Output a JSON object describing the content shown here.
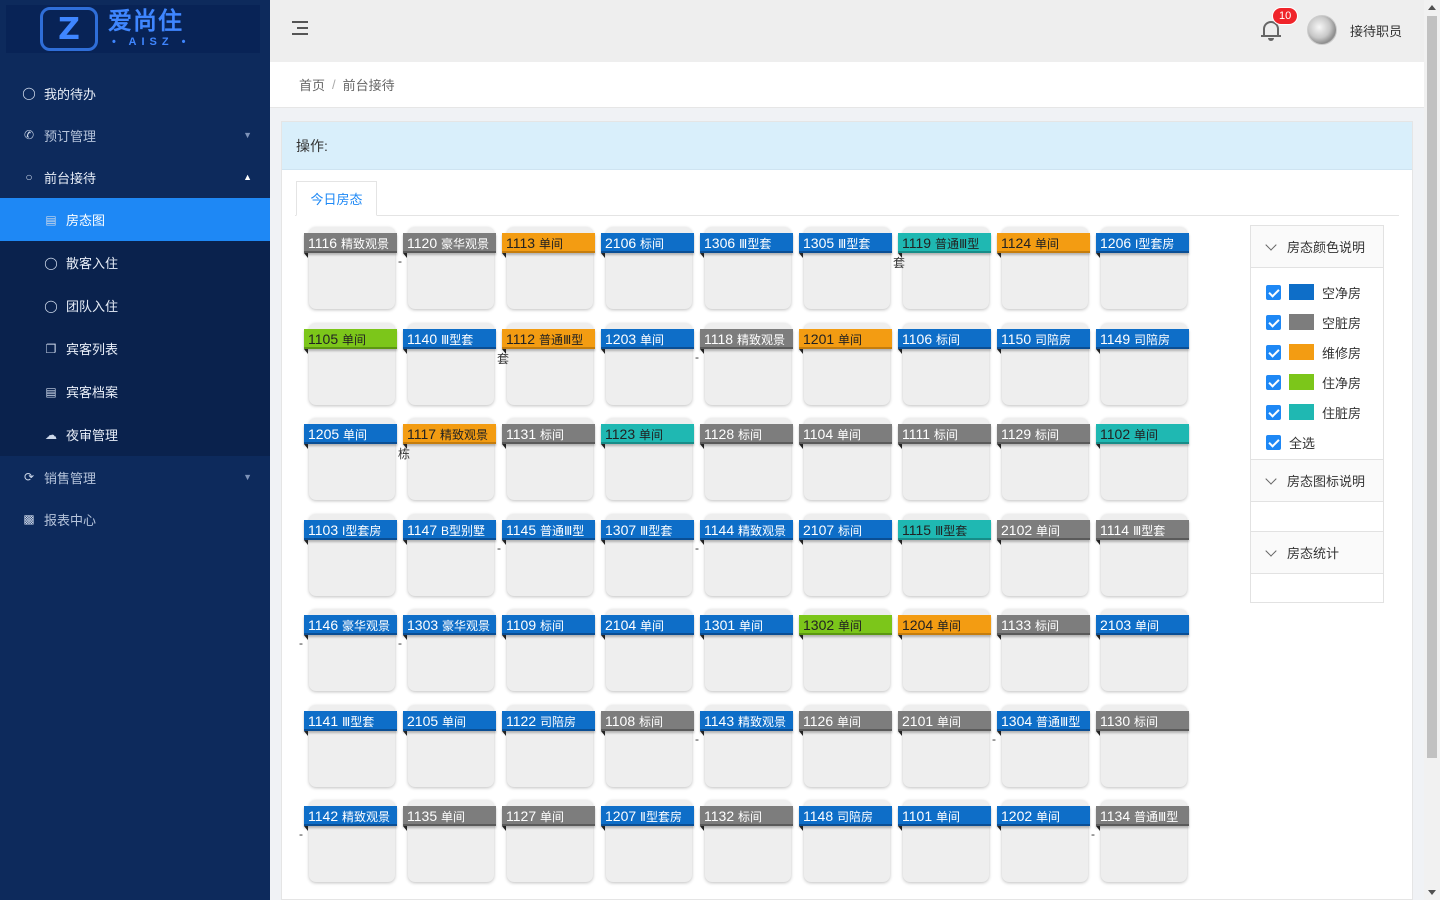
{
  "brand": {
    "logo_cn": "爱尚住",
    "logo_en": "• AISZ •"
  },
  "sidebar": {
    "items": [
      {
        "label": "我的待办",
        "icon": "user-icon"
      },
      {
        "label": "预订管理",
        "icon": "phone-icon",
        "arrow": "⌄"
      },
      {
        "label": "前台接待",
        "icon": "chat-icon",
        "arrow": "⌃"
      },
      {
        "label": "销售管理",
        "icon": "refresh-icon",
        "arrow": "⌄"
      },
      {
        "label": "报表中心",
        "icon": "bar-chart-icon"
      }
    ],
    "subitems": [
      {
        "label": "房态图",
        "icon": "chart-icon"
      },
      {
        "label": "散客入住",
        "icon": "user-icon"
      },
      {
        "label": "团队入住",
        "icon": "group-icon"
      },
      {
        "label": "宾客列表",
        "icon": "copy-icon"
      },
      {
        "label": "宾客档案",
        "icon": "file-icon"
      },
      {
        "label": "夜审管理",
        "icon": "cloud-icon"
      }
    ]
  },
  "header": {
    "notification_count": "10",
    "username": "接待职员"
  },
  "breadcrumb": {
    "home": "首页",
    "sep": "/",
    "current": "前台接待"
  },
  "panel": {
    "ops_label": "操作:",
    "tab_label": "今日房态"
  },
  "colors": {
    "空净房": "#0e6ec8",
    "空脏房": "#7d7d7d",
    "维修房": "#f39c12",
    "住净房": "#7cc61a",
    "住脏房": "#1fb8b2"
  },
  "rooms": [
    [
      {
        "no": "1116",
        "type": "精致观景",
        "c": "gray",
        "w": ""
      },
      {
        "no": "1120",
        "type": "豪华观景",
        "c": "gray",
        "w": "-"
      },
      {
        "no": "1113",
        "type": "单间",
        "c": "orange",
        "w": ""
      },
      {
        "no": "2106",
        "type": "标间",
        "c": "blue",
        "w": ""
      },
      {
        "no": "1306",
        "type": "Ⅲ型套",
        "c": "blue",
        "w": ""
      },
      {
        "no": "1305",
        "type": "Ⅲ型套",
        "c": "blue",
        "w": ""
      },
      {
        "no": "1119",
        "type": "普通Ⅲ型",
        "c": "teal",
        "w": "套"
      },
      {
        "no": "1124",
        "type": "单间",
        "c": "orange",
        "w": ""
      },
      {
        "no": "1206",
        "type": "I型套房",
        "c": "blue",
        "w": ""
      }
    ],
    [
      {
        "no": "1105",
        "type": "单间",
        "c": "green",
        "w": ""
      },
      {
        "no": "1140",
        "type": "Ⅲ型套",
        "c": "blue",
        "w": ""
      },
      {
        "no": "1112",
        "type": "普通Ⅲ型",
        "c": "orange",
        "w": "套"
      },
      {
        "no": "1203",
        "type": "单间",
        "c": "blue",
        "w": ""
      },
      {
        "no": "1118",
        "type": "精致观景",
        "c": "gray",
        "w": "-"
      },
      {
        "no": "1201",
        "type": "单间",
        "c": "orange",
        "w": ""
      },
      {
        "no": "1106",
        "type": "标间",
        "c": "blue",
        "w": ""
      },
      {
        "no": "1150",
        "type": "司陪房",
        "c": "blue",
        "w": ""
      },
      {
        "no": "1149",
        "type": "司陪房",
        "c": "blue",
        "w": ""
      }
    ],
    [
      {
        "no": "1205",
        "type": "单间",
        "c": "blue",
        "w": ""
      },
      {
        "no": "1117",
        "type": "精致观景",
        "c": "orange",
        "w": "栋"
      },
      {
        "no": "1131",
        "type": "标间",
        "c": "gray",
        "w": ""
      },
      {
        "no": "1123",
        "type": "单间",
        "c": "teal",
        "w": ""
      },
      {
        "no": "1128",
        "type": "标间",
        "c": "gray",
        "w": ""
      },
      {
        "no": "1104",
        "type": "单间",
        "c": "gray",
        "w": ""
      },
      {
        "no": "1111",
        "type": "标间",
        "c": "gray",
        "w": ""
      },
      {
        "no": "1129",
        "type": "标间",
        "c": "gray",
        "w": ""
      },
      {
        "no": "1102",
        "type": "单间",
        "c": "teal",
        "w": ""
      }
    ],
    [
      {
        "no": "1103",
        "type": "I型套房",
        "c": "blue",
        "w": ""
      },
      {
        "no": "1147",
        "type": "B型别墅",
        "c": "blue",
        "w": ""
      },
      {
        "no": "1145",
        "type": "普通Ⅲ型",
        "c": "blue",
        "w": "-"
      },
      {
        "no": "1307",
        "type": "Ⅲ型套",
        "c": "blue",
        "w": ""
      },
      {
        "no": "1144",
        "type": "精致观景",
        "c": "blue",
        "w": "-"
      },
      {
        "no": "2107",
        "type": "标间",
        "c": "blue",
        "w": ""
      },
      {
        "no": "1115",
        "type": "Ⅲ型套",
        "c": "teal",
        "w": ""
      },
      {
        "no": "2102",
        "type": "单间",
        "c": "gray",
        "w": ""
      },
      {
        "no": "1114",
        "type": "Ⅲ型套",
        "c": "gray",
        "w": ""
      }
    ],
    [
      {
        "no": "1146",
        "type": "豪华观景",
        "c": "blue",
        "w": "-"
      },
      {
        "no": "1303",
        "type": "豪华观景",
        "c": "blue",
        "w": "-"
      },
      {
        "no": "1109",
        "type": "标间",
        "c": "blue",
        "w": ""
      },
      {
        "no": "2104",
        "type": "单间",
        "c": "blue",
        "w": ""
      },
      {
        "no": "1301",
        "type": "单间",
        "c": "blue",
        "w": ""
      },
      {
        "no": "1302",
        "type": "单间",
        "c": "green",
        "w": ""
      },
      {
        "no": "1204",
        "type": "单间",
        "c": "orange",
        "w": ""
      },
      {
        "no": "1133",
        "type": "标间",
        "c": "gray",
        "w": ""
      },
      {
        "no": "2103",
        "type": "单间",
        "c": "blue",
        "w": ""
      }
    ],
    [
      {
        "no": "1141",
        "type": "Ⅲ型套",
        "c": "blue",
        "w": ""
      },
      {
        "no": "2105",
        "type": "单间",
        "c": "blue",
        "w": ""
      },
      {
        "no": "1122",
        "type": "司陪房",
        "c": "blue",
        "w": ""
      },
      {
        "no": "1108",
        "type": "标间",
        "c": "gray",
        "w": ""
      },
      {
        "no": "1143",
        "type": "精致观景",
        "c": "blue",
        "w": "-"
      },
      {
        "no": "1126",
        "type": "单间",
        "c": "gray",
        "w": ""
      },
      {
        "no": "2101",
        "type": "单间",
        "c": "gray",
        "w": ""
      },
      {
        "no": "1304",
        "type": "普通Ⅲ型",
        "c": "blue",
        "w": "-"
      },
      {
        "no": "1130",
        "type": "标间",
        "c": "gray",
        "w": ""
      }
    ],
    [
      {
        "no": "1142",
        "type": "精致观景",
        "c": "blue",
        "w": "-"
      },
      {
        "no": "1135",
        "type": "单间",
        "c": "gray",
        "w": ""
      },
      {
        "no": "1127",
        "type": "单间",
        "c": "gray",
        "w": ""
      },
      {
        "no": "1207",
        "type": "Ⅱ型套房",
        "c": "blue",
        "w": ""
      },
      {
        "no": "1132",
        "type": "标间",
        "c": "gray",
        "w": ""
      },
      {
        "no": "1148",
        "type": "司陪房",
        "c": "blue",
        "w": ""
      },
      {
        "no": "1101",
        "type": "单间",
        "c": "blue",
        "w": ""
      },
      {
        "no": "1202",
        "type": "单间",
        "c": "blue",
        "w": ""
      },
      {
        "no": "1134",
        "type": "普通Ⅲ型",
        "c": "gray",
        "w": "-"
      }
    ]
  ],
  "legend": {
    "color_title": "房态颜色说明",
    "items": [
      {
        "label": "空净房",
        "color": "#0e6ec8"
      },
      {
        "label": "空脏房",
        "color": "#7d7d7d"
      },
      {
        "label": "维修房",
        "color": "#f39c12"
      },
      {
        "label": "住净房",
        "color": "#7cc61a"
      },
      {
        "label": "住脏房",
        "color": "#1fb8b2"
      }
    ],
    "select_all": "全选",
    "icon_title": "房态图标说明",
    "stats_title": "房态统计"
  }
}
